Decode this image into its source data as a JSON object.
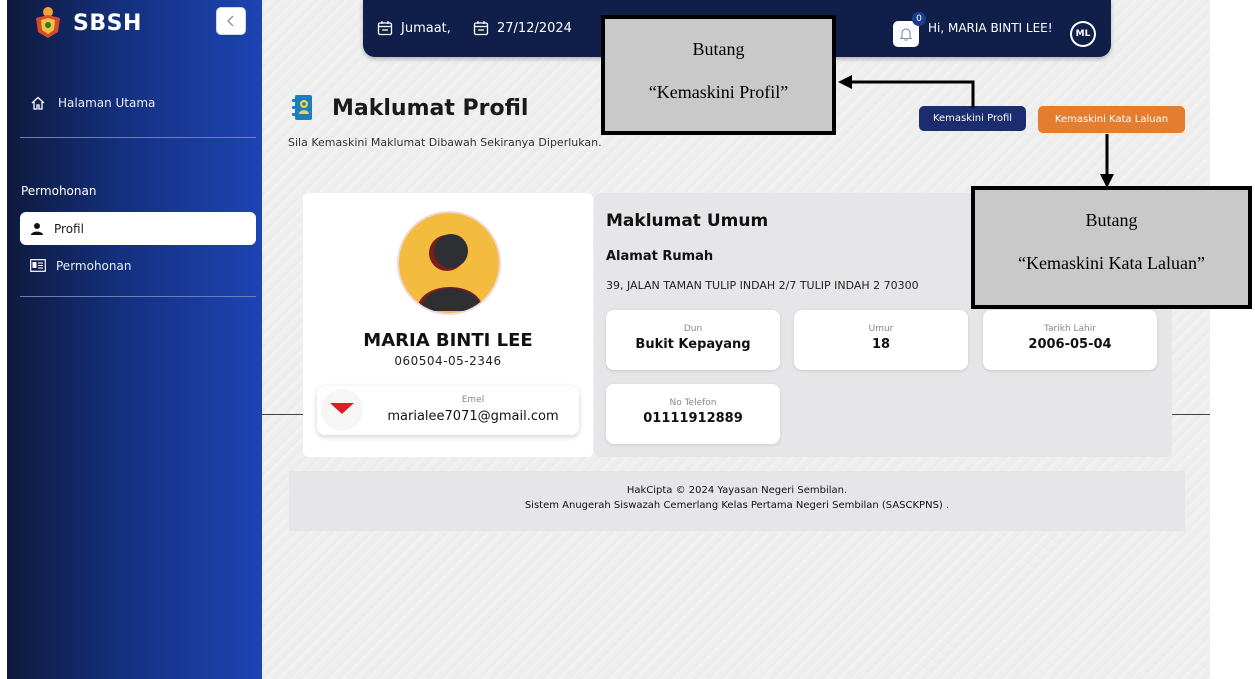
{
  "sidebar": {
    "brand": "SBSH",
    "home_label": "Halaman Utama",
    "section_title": "Permohonan",
    "items": [
      {
        "label": "Profil",
        "icon": "user-icon"
      },
      {
        "label": "Permohonan",
        "icon": "id-card-icon"
      }
    ]
  },
  "topbar": {
    "day": "Jumaat,",
    "date": "27/12/2024",
    "notifications": "0",
    "greeting": "Hi, MARIA BINTI LEE!",
    "avatar_initials": "ML"
  },
  "page": {
    "title": "Maklumat Profil",
    "subtitle": "Sila Kemaskini Maklumat Dibawah Sekiranya Diperlukan.",
    "btn_update_profile": "Kemaskini Profil",
    "btn_update_password": "Kemaskini Kata Laluan"
  },
  "profile": {
    "name": "MARIA BINTI LEE",
    "ic": "060504-05-2346",
    "email_label": "Emel",
    "email": "marialee7071@gmail.com"
  },
  "general": {
    "title": "Maklumat Umum",
    "address_label": "Alamat Rumah",
    "address": "39, JALAN TAMAN TULIP INDAH 2/7 TULIP INDAH 2 70300",
    "fields": [
      {
        "label": "Dun",
        "value": "Bukit Kepayang"
      },
      {
        "label": "Umur",
        "value": "18"
      },
      {
        "label": "Tarikh Lahir",
        "value": "2006-05-04"
      },
      {
        "label": "No Telefon",
        "value": "01111912889"
      }
    ]
  },
  "footer": {
    "line1": "HakCipta © 2024 Yayasan Negeri Sembilan.",
    "line2": "Sistem Anugerah Siswazah Cemerlang Kelas Pertama Negeri Sembilan (SASCKPNS) ."
  },
  "annotations": {
    "profile": {
      "line1": "Butang",
      "line2": "“Kemaskini Profil”"
    },
    "password": {
      "line1": "Butang",
      "line2": "“Kemaskini Kata Laluan”"
    }
  },
  "colors": {
    "sidebar_dark": "#0e1a3c",
    "sidebar_light": "#1c44b3",
    "topbar": "#0f1f49",
    "btn_profile": "#1b2d6e",
    "btn_password": "#e47d2e",
    "avatar_bg": "#f3bc3e"
  }
}
